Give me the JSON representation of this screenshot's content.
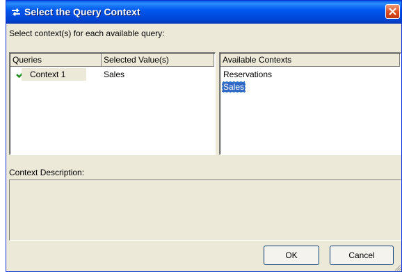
{
  "window": {
    "title": "Select the Query Context",
    "close_icon": "close-x-icon",
    "title_icon": "swap-arrows-icon"
  },
  "instruction": "Select context(s) for each available query:",
  "queries_table": {
    "headers": [
      "Queries",
      "Selected Value(s)"
    ],
    "rows": [
      {
        "query": "Context 1",
        "value": "Sales",
        "status_icon": "checkmark-icon"
      }
    ]
  },
  "available_contexts": {
    "header": "Available Contexts",
    "items": [
      "Reservations",
      "Sales"
    ],
    "selected": "Sales"
  },
  "description": {
    "label": "Context Description:",
    "text": ""
  },
  "buttons": {
    "ok": "OK",
    "cancel": "Cancel"
  },
  "colors": {
    "titlebar": "#0058ee",
    "selection": "#316ac5",
    "check": "#228b22",
    "close_button": "#d9471b"
  }
}
